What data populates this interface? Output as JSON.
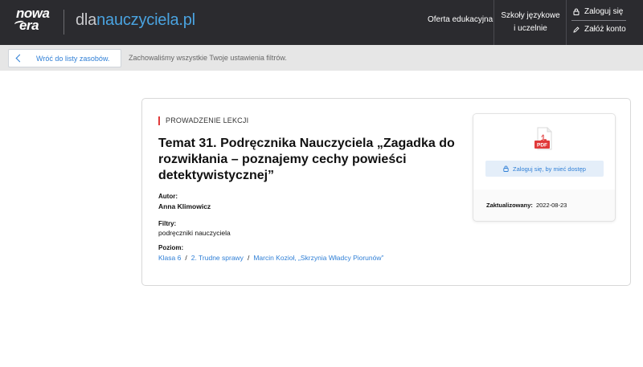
{
  "header": {
    "logo_line1": "nowa",
    "logo_line2": "era",
    "site_name_prefix": "dla",
    "site_name_suffix": "nauczyciela.pl",
    "nav_offer": "Oferta edukacyjna",
    "nav_schools": "Szkoły językowe i uczelnie",
    "nav_login": "Zaloguj się",
    "nav_register": "Załóż konto"
  },
  "subbar": {
    "back_label": "Wróć do listy zasobów.",
    "filters_note": "Zachowaliśmy wszystkie Twoje ustawienia filtrów."
  },
  "resource": {
    "category": "PROWADZENIE LEKCJI",
    "title": "Temat 31. Podręcznika Nauczyciela „Zagadka do rozwikłania – poznajemy cechy powieści detektywistycznej”",
    "author_label": "Autor:",
    "author": "Anna Klimowicz",
    "filters_label": "Filtry:",
    "filters": "podręczniki nauczyciela",
    "level_label": "Poziom:",
    "levels": [
      "Klasa 6",
      "2. Trudne sprawy",
      "Marcin Kozioł, „Skrzynia Władcy Piorunów”"
    ],
    "level_separator": "/"
  },
  "side_panel": {
    "file_icon": "pdf-icon",
    "file_type": "PDF",
    "access_label": "Zaloguj się, by mieć dostęp",
    "updated_label": "Zaktualizowany:",
    "updated_date": "2022-08-23"
  },
  "colors": {
    "header_bg": "#2b2b2f",
    "accent_blue": "#2f7fd6",
    "category_bar": "#e03a3a",
    "pdf_red": "#e03a3a"
  }
}
